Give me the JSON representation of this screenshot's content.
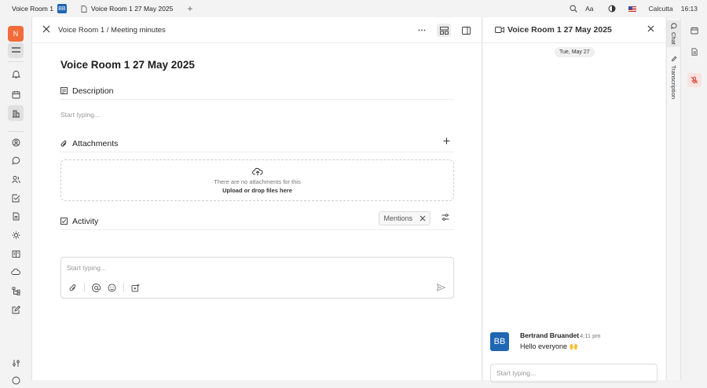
{
  "topbar": {
    "tab1_label": "Voice Room 1",
    "tab1_badge": "BB",
    "tab2_label": "Voice Room 1 27 May 2025",
    "new_tab_glyph": "+",
    "font_label": "Aa",
    "city": "Calcutta",
    "time": "16:13"
  },
  "sidebar": {
    "avatar_initial": "N",
    "accent_color": "#f26b3a",
    "icons": [
      "menu-icon",
      "bell-icon",
      "calendar-icon",
      "office-icon",
      "contacts-icon",
      "chat-icon",
      "people-icon",
      "checklist-icon",
      "document-icon",
      "sun-icon",
      "book-icon",
      "cloud-icon",
      "tree-icon",
      "edit-icon",
      "settings-sliders-icon",
      "help-icon"
    ]
  },
  "main": {
    "breadcrumb": "Voice Room 1  /  Meeting minutes",
    "title": "Voice Room 1 27 May 2025",
    "description_label": "Description",
    "description_placeholder": "Start typing...",
    "attachments_label": "Attachments",
    "attachments_empty": "There are no attachments for this",
    "attachments_upload": "Upload or drop files here",
    "activity_label": "Activity",
    "mentions_label": "Mentions",
    "composer_placeholder": "Start typing..."
  },
  "chat": {
    "title": "Voice Room 1 27 May 2025",
    "date": "Tue, May 27",
    "message": {
      "avatar": "BB",
      "author": "Bertrand Bruandet",
      "time": "4:11 pm",
      "text": "Hello everyone 🙌"
    },
    "input_placeholder": "Start typing..."
  },
  "side_tabs": {
    "chat_label": "Chat",
    "transcription_label": "Transcription"
  },
  "colors": {
    "brand_blue": "#1f66b3",
    "alert_red": "#d64030"
  }
}
